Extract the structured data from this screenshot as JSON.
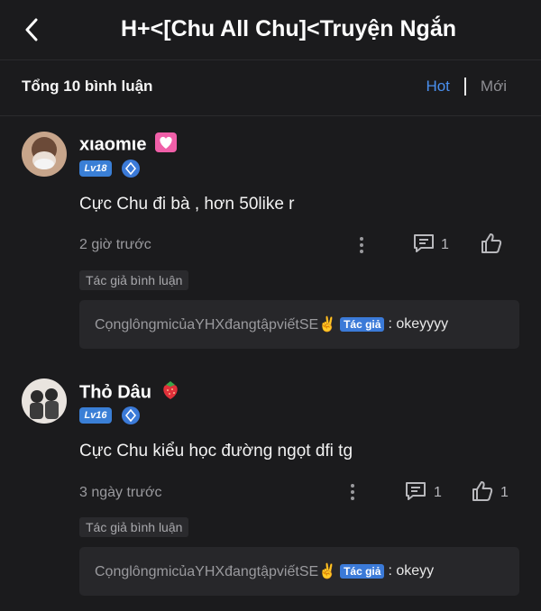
{
  "header": {
    "title": "H+<[Chu All Chu]<Truyện Ngắn"
  },
  "toolbar": {
    "count_label": "Tổng 10 bình luận",
    "sort_hot": "Hot",
    "sort_new": "Mới"
  },
  "comments": [
    {
      "user": "xιaomιe",
      "badge_icon": "heart-badge-icon",
      "level": "Lv18",
      "text": "Cực Chu đi bà , hơn 50like r",
      "time": "2 giờ trước",
      "reply_count": "1",
      "like_count": "",
      "author_tag": "Tác giả bình luận",
      "reply": {
        "user": "CọnglôngmicủaYHXđangtậpviếtSE✌️",
        "tag": "Tác giả",
        "message": ": okeyyyy"
      }
    },
    {
      "user": "Thỏ Dâu",
      "badge_icon": "strawberry-icon",
      "level": "Lv16",
      "text": "Cực Chu kiểu học đường ngọt dfi tg",
      "time": "3 ngày trước",
      "reply_count": "1",
      "like_count": "1",
      "author_tag": "Tác giả bình luận",
      "reply": {
        "user": "CọnglôngmicủaYHXđangtậpviếtSE✌️",
        "tag": "Tác giả",
        "message": ": okeyy"
      }
    }
  ],
  "colors": {
    "background": "#1b1b1d",
    "accent": "#4a90f0",
    "level_badge": "#3a7fd6"
  }
}
